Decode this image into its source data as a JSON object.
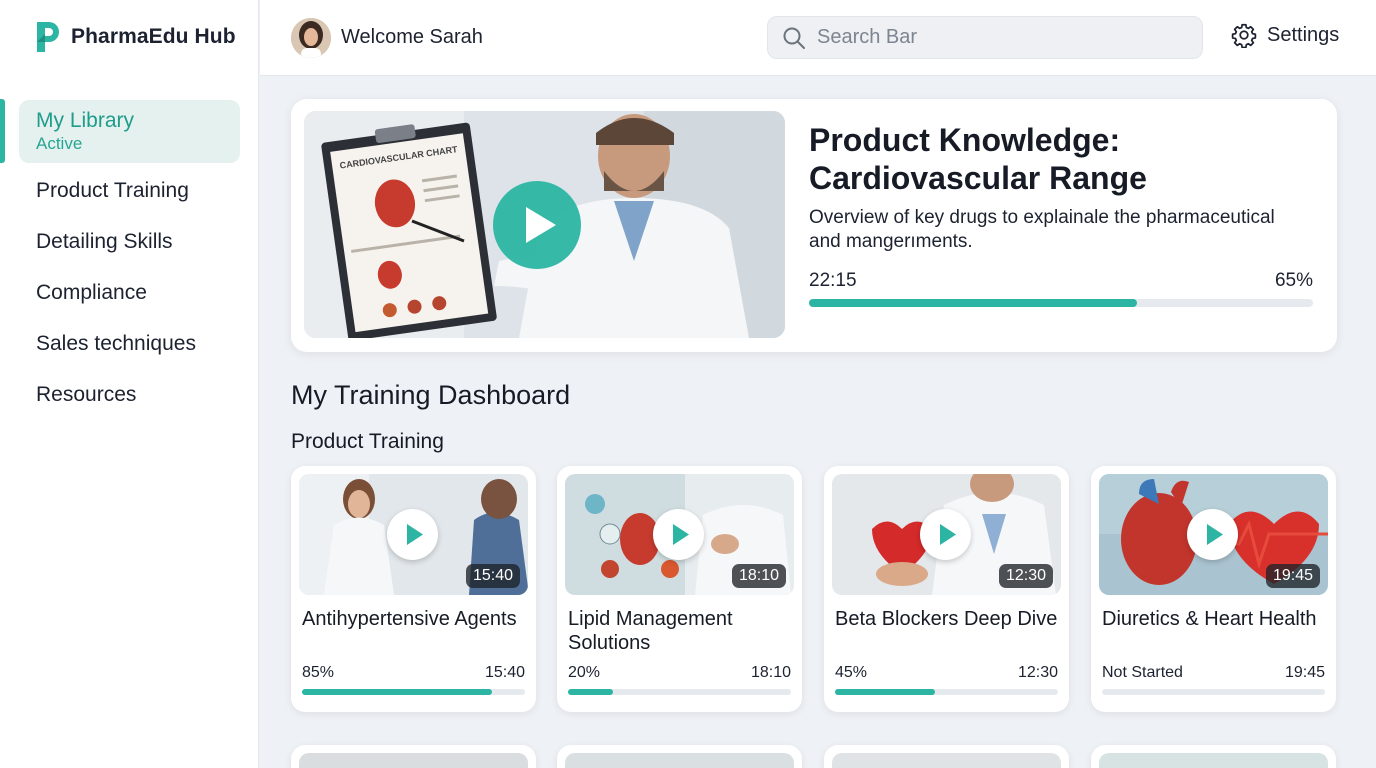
{
  "brand": {
    "name": "PharmaEdu Hub",
    "accent": "#2bb5a2"
  },
  "sidebar": {
    "items": [
      {
        "label": "My Library",
        "status": "Active"
      },
      {
        "label": "Product Training"
      },
      {
        "label": "Detailing Skills"
      },
      {
        "label": "Compliance"
      },
      {
        "label": "Sales techniques"
      },
      {
        "label": "Resources"
      }
    ]
  },
  "header": {
    "welcome": "Welcome Sarah",
    "search_placeholder": "Search Bar",
    "settings_label": "Settings"
  },
  "featured": {
    "title": "Product Knowledge: Cardiovascular Range",
    "description": "Overview of key drugs to explainale the pharmaceutical and mangerıments.",
    "duration": "22:15",
    "progress_label": "65%",
    "progress": 0.65,
    "thumbnail_text": "CARDIOVASCULAR CHART"
  },
  "dashboard": {
    "title": "My Training Dashboard",
    "section_title": "Product Training",
    "courses": [
      {
        "title": "Antihypertensive Agents",
        "status": "85%",
        "progress": 0.85,
        "duration": "15:40",
        "badge": "15:40"
      },
      {
        "title": "Lipid Management Solutions",
        "status": "20%",
        "progress": 0.2,
        "duration": "18:10",
        "badge": "18:10"
      },
      {
        "title": "Beta Blockers Deep Dive",
        "status": "45%",
        "progress": 0.45,
        "duration": "12:30",
        "badge": "12:30"
      },
      {
        "title": "Diuretics & Heart Health",
        "status": "Not Started",
        "progress": 0,
        "duration": "19:45",
        "badge": "19:45"
      }
    ]
  },
  "icons": [
    "logo-icon",
    "search-icon",
    "gear-icon",
    "play-icon",
    "avatar"
  ]
}
